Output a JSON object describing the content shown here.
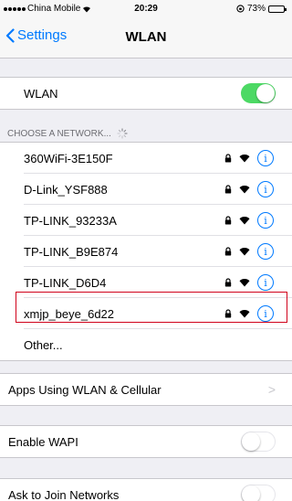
{
  "status": {
    "carrier": "China Mobile",
    "time": "20:29",
    "battery": "73%",
    "battery_level": 0.73
  },
  "nav": {
    "back_label": "Settings",
    "title": "WLAN"
  },
  "wlan": {
    "label": "WLAN",
    "enabled": true
  },
  "networks_header": "CHOOSE A NETWORK...",
  "networks": [
    {
      "name": "360WiFi-3E150F"
    },
    {
      "name": "D-Link_YSF888"
    },
    {
      "name": "TP-LINK_93233A"
    },
    {
      "name": "TP-LINK_B9E874"
    },
    {
      "name": "TP-LINK_D6D4"
    },
    {
      "name": "xmjp_beye_6d22"
    }
  ],
  "other_label": "Other...",
  "apps_row": {
    "label": "Apps Using WLAN & Cellular",
    "chevron": ">"
  },
  "wapi": {
    "label": "Enable WAPI",
    "enabled": false
  },
  "ask_join": {
    "label": "Ask to Join Networks",
    "enabled": false
  },
  "info_glyph": "i",
  "colors": {
    "accent": "#007aff",
    "toggle_on": "#4cd964",
    "highlight": "#d0021b"
  }
}
